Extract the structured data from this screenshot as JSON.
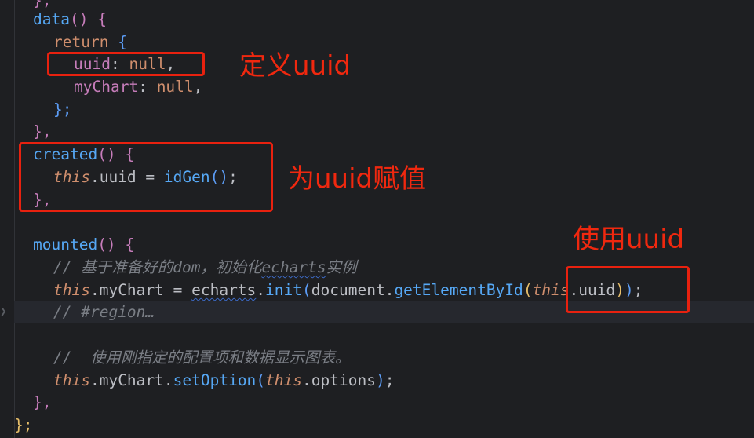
{
  "code": {
    "l0": "},",
    "l1_fn": "data",
    "l1_paren": "()",
    "l1_brace": "{",
    "l2_kw": "return",
    "l2_brace": "{",
    "l3_key": "uuid",
    "l3_colon": ":",
    "l3_val": "null",
    "l3_comma": ",",
    "l4_key": "myChart",
    "l4_colon": ":",
    "l4_val": "null",
    "l4_comma": ",",
    "l5": "};",
    "l6": "},",
    "l7_fn": "created",
    "l7_paren": "()",
    "l7_brace": "{",
    "l8_this": "this",
    "l8_dot": ".uuid = ",
    "l8_fn": "idGen",
    "l8_paren": "()",
    "l8_semi": ";",
    "l9": "},",
    "l10_fn": "mounted",
    "l10_paren": "()",
    "l10_brace": "{",
    "l11_comment_a": "// 基于准备好的dom，初始化",
    "l11_comment_b": "echarts",
    "l11_comment_c": "实例",
    "l12_this": "this",
    "l12_a": ".myChart = ",
    "l12_echarts": "echarts",
    "l12_b": ".",
    "l12_init": "init",
    "l12_p1": "(",
    "l12_doc": "document.",
    "l12_get": "getElementById",
    "l12_p2": "(",
    "l12_this2": "this",
    "l12_uuid": ".uuid",
    "l12_p3": ")",
    "l12_p4": ")",
    "l12_semi": ";",
    "l13": "// #region…",
    "l15": "//  使用刚指定的配置项和数据显示图表。",
    "l16_this": "this",
    "l16_a": ".myChart.",
    "l16_fn": "setOption",
    "l16_p1": "(",
    "l16_this2": "this",
    "l16_b": ".options",
    "l16_p2": ")",
    "l16_semi": ";",
    "l17": "},",
    "l18": "};"
  },
  "annotations": {
    "define": "定义uuid",
    "assign": "为uuid赋值",
    "use": "使用uuid"
  },
  "colors": {
    "annotation": "#f0280f",
    "box": "#e8210f",
    "background": "#1e1f22"
  }
}
